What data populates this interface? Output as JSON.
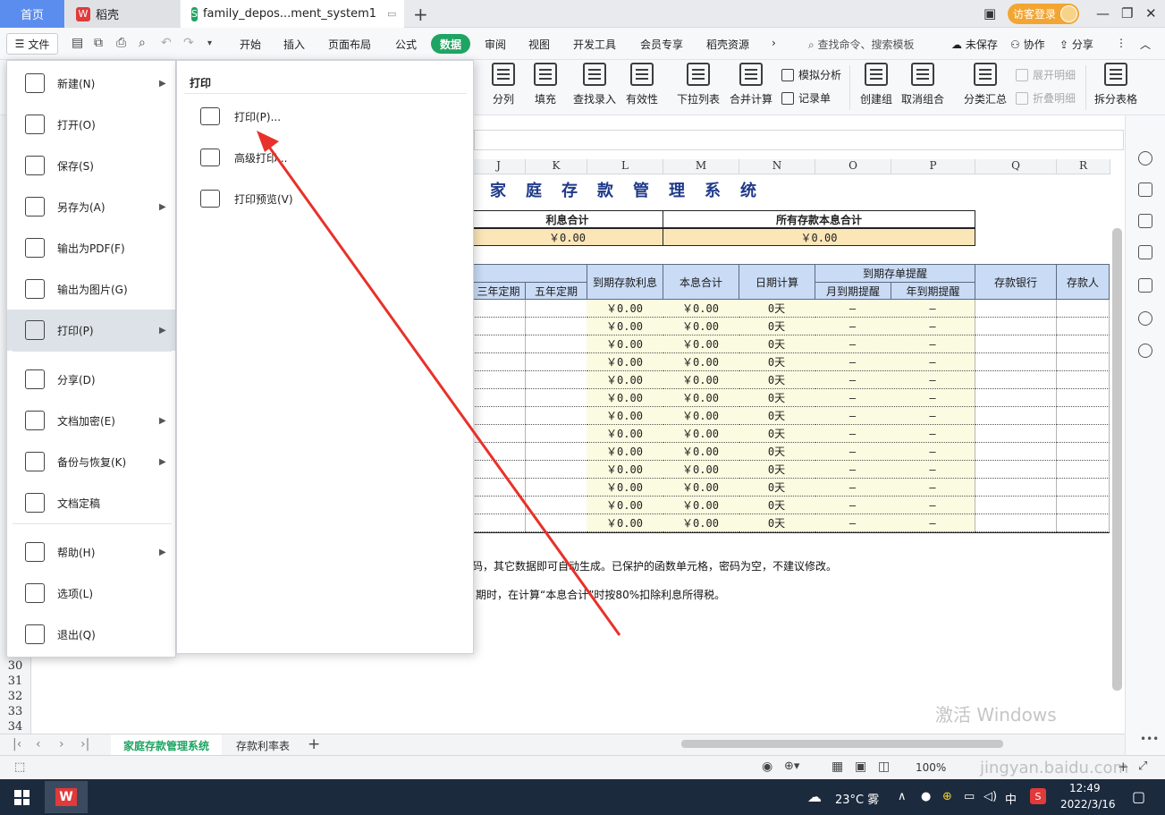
{
  "tabs": {
    "home": "首页",
    "daoke": "稻壳",
    "doc": "family_depos...ment_system1",
    "login": "访客登录"
  },
  "menu": {
    "file": "文件",
    "items": [
      "开始",
      "插入",
      "页面布局",
      "公式",
      "数据",
      "审阅",
      "视图",
      "开发工具",
      "会员专享",
      "稻壳资源"
    ],
    "active": "数据",
    "search": "查找命令、搜索模板",
    "unsaved": "未保存",
    "collab": "协作",
    "share": "分享"
  },
  "ribbon": {
    "split": "分列",
    "fill": "填充",
    "lookup": "查找录入",
    "validity": "有效性",
    "dropdown": "下拉列表",
    "consolidate": "合并计算",
    "simulate": "模拟分析",
    "record": "记录单",
    "group": "创建组",
    "ungroup": "取消组合",
    "subtotal": "分类汇总",
    "expand": "展开明细",
    "collapse": "折叠明细",
    "split_table": "拆分表格"
  },
  "file_menu": [
    {
      "label": "新建(N)",
      "icon": "new-file-icon",
      "arrow": true
    },
    {
      "label": "打开(O)",
      "icon": "folder-icon",
      "arrow": false
    },
    {
      "label": "保存(S)",
      "icon": "save-icon",
      "arrow": false
    },
    {
      "label": "另存为(A)",
      "icon": "save-as-icon",
      "arrow": true
    },
    {
      "label": "输出为PDF(F)",
      "icon": "pdf-icon",
      "arrow": false
    },
    {
      "label": "输出为图片(G)",
      "icon": "image-icon",
      "arrow": false
    },
    {
      "label": "打印(P)",
      "icon": "printer-icon",
      "arrow": true
    },
    {
      "label": "分享(D)",
      "icon": "share-icon",
      "arrow": false
    },
    {
      "label": "文档加密(E)",
      "icon": "lock-doc-icon",
      "arrow": true
    },
    {
      "label": "备份与恢复(K)",
      "icon": "backup-icon",
      "arrow": true
    },
    {
      "label": "文档定稿",
      "icon": "finalize-icon",
      "arrow": false
    },
    {
      "label": "帮助(H)",
      "icon": "help-icon",
      "arrow": true
    },
    {
      "label": "选项(L)",
      "icon": "gear-icon",
      "arrow": false
    },
    {
      "label": "退出(Q)",
      "icon": "exit-icon",
      "arrow": false
    }
  ],
  "print_panel": {
    "title": "打印",
    "items": [
      "打印(P)...",
      "高级打印...",
      "打印预览(V)"
    ]
  },
  "sheet": {
    "columns": [
      "J",
      "K",
      "L",
      "M",
      "N",
      "O",
      "P",
      "Q",
      "R"
    ],
    "title": "家庭存款管理系统",
    "interest_total_label": "利息合计",
    "all_total_label": "所有存款本息合计",
    "interest_total_value": "￥0.00",
    "all_total_value": "￥0.00",
    "headers": {
      "three_year": "三年定期",
      "five_year": "五年定期",
      "maturity_interest": "到期存款利息",
      "principal_interest": "本息合计",
      "date_calc": "日期计算",
      "reminder": "到期存单提醒",
      "month_reminder": "月到期提醒",
      "year_reminder": "年到期提醒",
      "bank": "存款银行",
      "depositor": "存款人"
    },
    "row_values": {
      "interest": "￥0.00",
      "total": "￥0.00",
      "days": "0天",
      "dash": "—"
    },
    "row_count": 13,
    "note1": "码，其它数据即可自动生成。已保护的函数单元格，密码为空，不建议修改。",
    "note2": "期时，在计算“本息合计”时按80%扣除利息所得税。",
    "row_numbers": [
      "30",
      "31",
      "32",
      "33",
      "34"
    ]
  },
  "sheet_tabs": [
    "家庭存款管理系统",
    "存款利率表"
  ],
  "status": {
    "zoom": "100%"
  },
  "taskbar": {
    "weather": "23°C 雾",
    "ime": "中",
    "time": "12:49",
    "date": "2022/3/16"
  },
  "watermark": {
    "line1": "激活 Windows",
    "line2": "jingyan.baidu.com"
  },
  "colors": {
    "accent": "#1fa463",
    "arrow": "#e8312a",
    "header_blue": "#c9dbf5",
    "sum_yellow": "#fbe6b8"
  }
}
